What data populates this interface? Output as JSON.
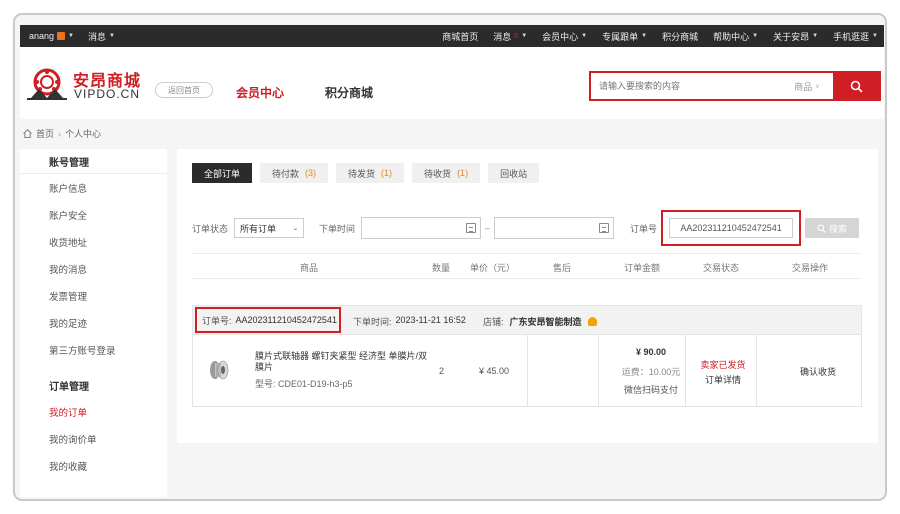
{
  "topbar": {
    "username": "anang",
    "messages": "消息",
    "links": [
      {
        "label": "商城首页",
        "caret": false
      },
      {
        "label": "消息",
        "caret": true,
        "badge": "0"
      },
      {
        "label": "会员中心",
        "caret": true
      },
      {
        "label": "专属跟单",
        "caret": true
      },
      {
        "label": "积分商城",
        "caret": false
      },
      {
        "label": "帮助中心",
        "caret": true
      },
      {
        "label": "关于安昂",
        "caret": true
      },
      {
        "label": "手机逛逛",
        "caret": true
      }
    ]
  },
  "header": {
    "logo_cn": "安昂商城",
    "logo_en": "VIPDO.CN",
    "back_label": "返回首页",
    "nav_member": "会员中心",
    "nav_points": "积分商城",
    "search_placeholder": "请输入要搜索的内容",
    "search_category": "商品"
  },
  "breadcrumb": {
    "home": "首页",
    "current": "个人中心"
  },
  "sidebar": {
    "account_title": "账号管理",
    "account_items": [
      "账户信息",
      "账户安全",
      "收货地址",
      "我的消息",
      "发票管理",
      "我的足迹",
      "第三方账号登录"
    ],
    "order_title": "订单管理",
    "order_items": [
      "我的订单",
      "我的询价单",
      "我的收藏"
    ]
  },
  "tabs": [
    {
      "label": "全部订单",
      "count": ""
    },
    {
      "label": "待付款",
      "count": "(3)"
    },
    {
      "label": "待发货",
      "count": "(1)"
    },
    {
      "label": "待收货",
      "count": "(1)"
    },
    {
      "label": "回收站",
      "count": ""
    }
  ],
  "filters": {
    "status_label": "订单状态",
    "status_value": "所有订单",
    "time_label": "下单时间",
    "dash": "–",
    "order_no_label": "订单号",
    "order_no_value": "AA202311210452472541",
    "search_label": "搜索"
  },
  "table_headers": [
    "商品",
    "数量",
    "单价（元）",
    "售后",
    "订单金额",
    "交易状态",
    "交易操作"
  ],
  "order": {
    "no_label": "订单号:",
    "no_value": "AA202311210452472541",
    "time_label": "下单时间:",
    "time_value": "2023-11-21 16:52",
    "shop_label": "店铺:",
    "shop_value": "广东安昂智能制造",
    "product_name": "膜片式联轴器 螺钉夹紧型 经济型 单膜片/双膜片",
    "product_model": "型号: CDE01-D19-h3-p5",
    "quantity": "2",
    "unit_price": "¥ 45.00",
    "total": "¥ 90.00",
    "freight": "运费：10.00元",
    "pay_method": "微信扫码支付",
    "status": "卖家已发货",
    "detail_link": "订单详情",
    "action": "确认收货"
  },
  "colors": {
    "brand_red": "#cf1e24",
    "topbar_bg": "#2b2b2b",
    "count_orange": "#e08a1e"
  }
}
